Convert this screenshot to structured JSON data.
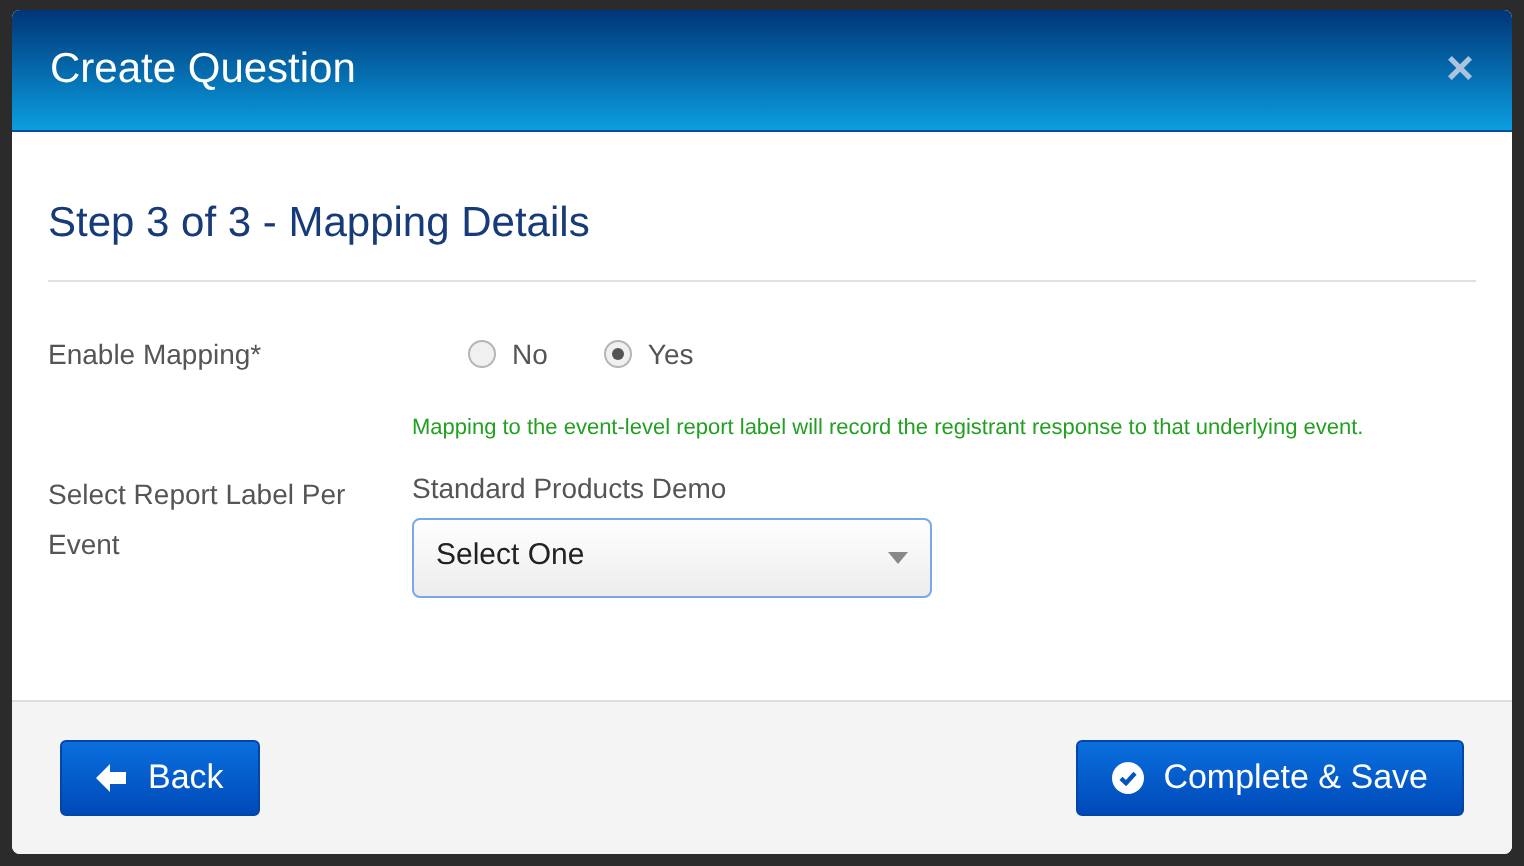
{
  "dialog": {
    "title": "Create Question",
    "close": "×"
  },
  "step_title": "Step 3 of 3 - Mapping Details",
  "enable_mapping": {
    "label": "Enable Mapping*",
    "options": [
      {
        "label": "No",
        "selected": false
      },
      {
        "label": "Yes",
        "selected": true
      }
    ],
    "hint": "Mapping to the event-level report label will record the registrant response to that underlying event."
  },
  "report_label": {
    "label": "Select Report Label Per Event",
    "event_name": "Standard Products Demo",
    "value": "Select One"
  },
  "buttons": [
    {
      "kind": "back",
      "label": "Back"
    },
    {
      "kind": "complete",
      "label": "Complete & Save"
    }
  ]
}
